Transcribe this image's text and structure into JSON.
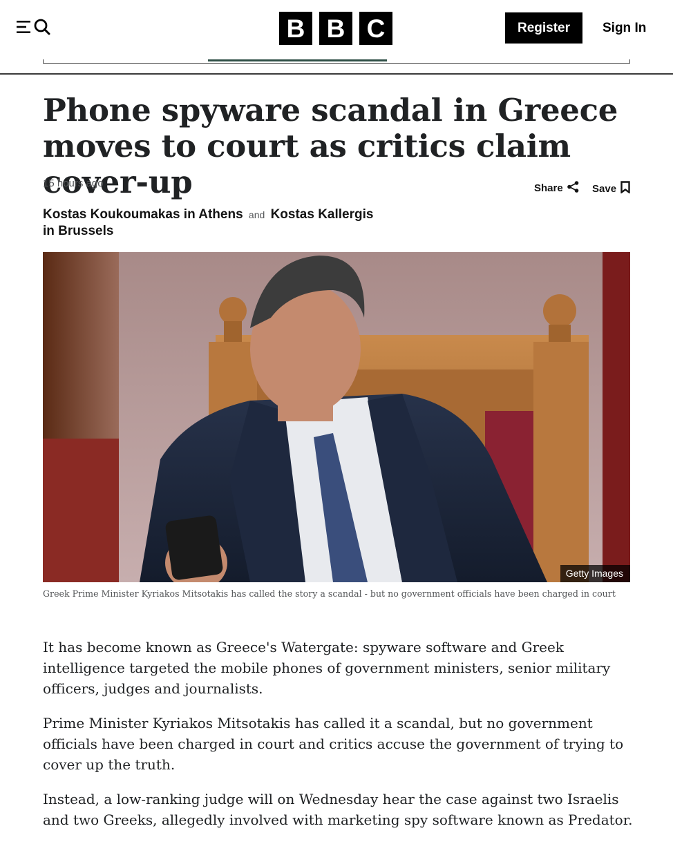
{
  "header": {
    "menu_icon": "menu-icon",
    "search_icon": "search-icon",
    "logo_letters": [
      "B",
      "B",
      "C"
    ],
    "register_label": "Register",
    "signin_label": "Sign In"
  },
  "article": {
    "headline": "Phone spyware scandal in Greece moves to court as critics claim cover-up",
    "timestamp": "15 hours ago",
    "share_label": "Share",
    "share_icon": "share-icon",
    "save_label": "Save",
    "save_icon": "bookmark-icon",
    "byline": {
      "author1": "Kostas Koukoumakas in Athens",
      "and": "and",
      "author2": "Kostas Kallergis in Brussels"
    },
    "image": {
      "credit": "Getty Images",
      "caption": "Greek Prime Minister Kyriakos Mitsotakis has called the story a scandal - but no government officials have been charged in court"
    },
    "paragraphs": [
      "It has become known as Greece's Watergate: spyware software and Greek intelligence targeted the mobile phones of government ministers, senior military officers, judges and journalists.",
      "Prime Minister Kyriakos Mitsotakis has called it a scandal, but no government officials have been charged in court and critics accuse the government of trying to cover up the truth.",
      "Instead, a low-ranking judge will on Wednesday hear the case against two Israelis and two Greeks, allegedly involved with marketing spy software known as Predator."
    ]
  },
  "colors": {
    "brand_black": "#000000",
    "text": "#202224",
    "muted": "#545658"
  }
}
